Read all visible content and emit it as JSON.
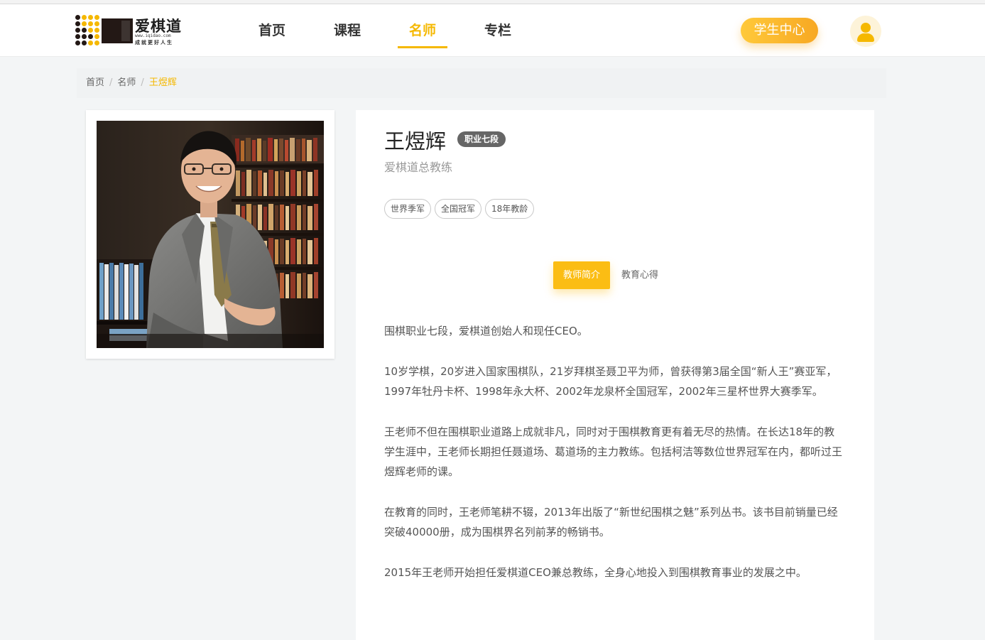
{
  "brand": {
    "name": "爱棋道",
    "url": "www.iqidao.com",
    "slogan": "成就更好人生",
    "colors": {
      "accent": "#f5b800",
      "dark": "#231815"
    }
  },
  "nav": {
    "items": [
      {
        "label": "首页",
        "active": false
      },
      {
        "label": "课程",
        "active": false
      },
      {
        "label": "名师",
        "active": true
      },
      {
        "label": "专栏",
        "active": false
      }
    ],
    "student_center": "学生中心",
    "avatar_icon": "user-icon"
  },
  "breadcrumb": {
    "items": [
      "首页",
      "名师"
    ],
    "current": "王煜辉",
    "separator": "/"
  },
  "teacher": {
    "name": "王煜辉",
    "rank": "职业七段",
    "title": "爱棋道总教练",
    "tags": [
      "世界季军",
      "全国冠军",
      "18年教龄"
    ],
    "photo": "teacher-portrait"
  },
  "tabs": {
    "items": [
      {
        "label": "教师简介",
        "active": true
      },
      {
        "label": "教育心得",
        "active": false
      }
    ]
  },
  "intro": {
    "paragraphs": [
      "围棋职业七段，爱棋道创始人和现任CEO。",
      "10岁学棋，20岁进入国家围棋队，21岁拜棋圣聂卫平为师，曾获得第3届全国“新人王”赛亚军，1997年牡丹卡杯、1998年永大杯、2002年龙泉杯全国冠军，2002年三星杯世界大赛季军。",
      "王老师不但在围棋职业道路上成就非凡，同时对于围棋教育更有着无尽的热情。在长达18年的教学生涯中，王老师长期担任聂道场、葛道场的主力教练。包括柯洁等数位世界冠军在内，都听过王煜辉老师的课。",
      "在教育的同时，王老师笔耕不辍，2013年出版了“新世纪围棋之魅”系列丛书。该书目前销量已经突破40000册，成为围棋界名列前茅的畅销书。",
      "2015年王老师开始担任爱棋道CEO兼总教练，全身心地投入到围棋教育事业的发展之中。"
    ]
  }
}
